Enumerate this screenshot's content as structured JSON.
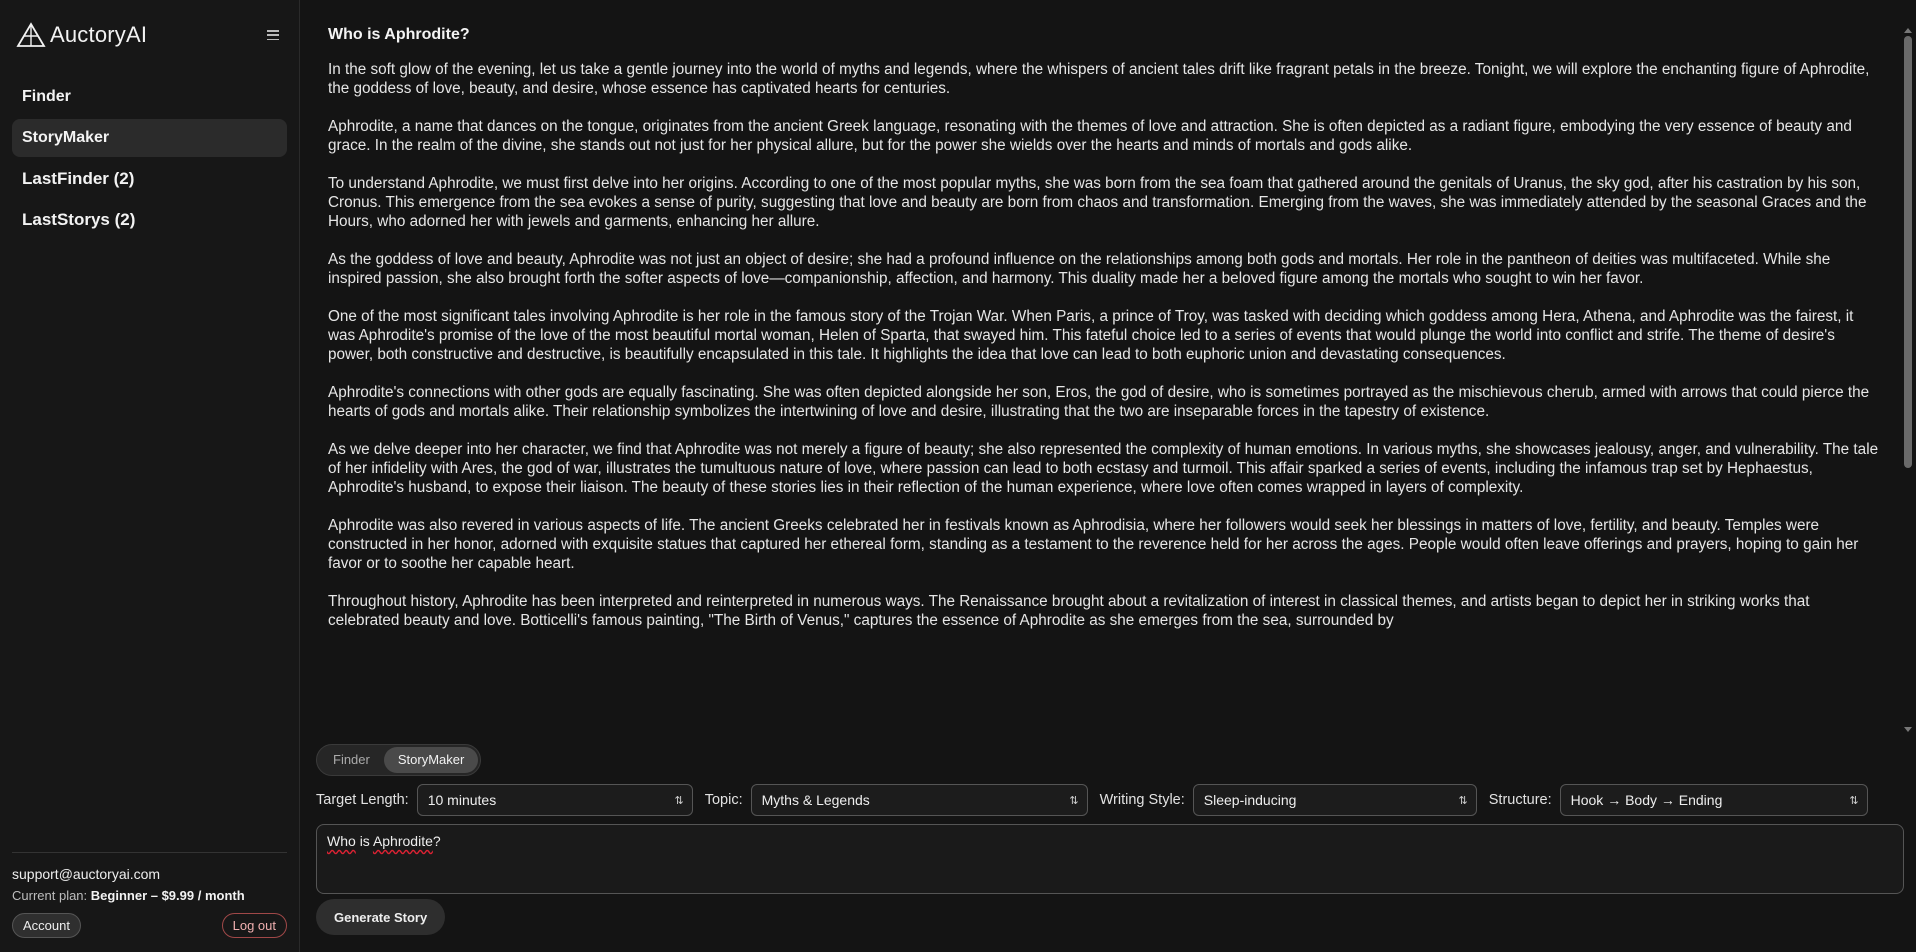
{
  "app": {
    "name": "AuctoryAI"
  },
  "sidebar": {
    "items": [
      {
        "label": "Finder"
      },
      {
        "label": "StoryMaker",
        "active": true
      },
      {
        "label": "LastFinder (2)"
      },
      {
        "label": "LastStorys (2)"
      }
    ],
    "footer": {
      "email": "support@auctoryai.com",
      "plan_label": "Current plan:",
      "plan_value": "Beginner – $9.99 / month",
      "account_label": "Account",
      "logout_label": "Log out"
    }
  },
  "story": {
    "title": "Who is Aphrodite?",
    "paragraphs": [
      "In the soft glow of the evening, let us take a gentle journey into the world of myths and legends, where the whispers of ancient tales drift like fragrant petals in the breeze. Tonight, we will explore the enchanting figure of Aphrodite, the goddess of love, beauty, and desire, whose essence has captivated hearts for centuries.",
      "Aphrodite, a name that dances on the tongue, originates from the ancient Greek language, resonating with the themes of love and attraction. She is often depicted as a radiant figure, embodying the very essence of beauty and grace. In the realm of the divine, she stands out not just for her physical allure, but for the power she wields over the hearts and minds of mortals and gods alike.",
      "To understand Aphrodite, we must first delve into her origins. According to one of the most popular myths, she was born from the sea foam that gathered around the genitals of Uranus, the sky god, after his castration by his son, Cronus. This emergence from the sea evokes a sense of purity, suggesting that love and beauty are born from chaos and transformation. Emerging from the waves, she was immediately attended by the seasonal Graces and the Hours, who adorned her with jewels and garments, enhancing her allure.",
      "As the goddess of love and beauty, Aphrodite was not just an object of desire; she had a profound influence on the relationships among both gods and mortals. Her role in the pantheon of deities was multifaceted. While she inspired passion, she also brought forth the softer aspects of love—companionship, affection, and harmony. This duality made her a beloved figure among the mortals who sought to win her favor.",
      "One of the most significant tales involving Aphrodite is her role in the famous story of the Trojan War. When Paris, a prince of Troy, was tasked with deciding which goddess among Hera, Athena, and Aphrodite was the fairest, it was Aphrodite's promise of the love of the most beautiful mortal woman, Helen of Sparta, that swayed him. This fateful choice led to a series of events that would plunge the world into conflict and strife. The theme of desire's power, both constructive and destructive, is beautifully encapsulated in this tale. It highlights the idea that love can lead to both euphoric union and devastating consequences.",
      "Aphrodite's connections with other gods are equally fascinating. She was often depicted alongside her son, Eros, the god of desire, who is sometimes portrayed as the mischievous cherub, armed with arrows that could pierce the hearts of gods and mortals alike. Their relationship symbolizes the intertwining of love and desire, illustrating that the two are inseparable forces in the tapestry of existence.",
      "As we delve deeper into her character, we find that Aphrodite was not merely a figure of beauty; she also represented the complexity of human emotions. In various myths, she showcases jealousy, anger, and vulnerability. The tale of her infidelity with Ares, the god of war, illustrates the tumultuous nature of love, where passion can lead to both ecstasy and turmoil. This affair sparked a series of events, including the infamous trap set by Hephaestus, Aphrodite's husband, to expose their liaison. The beauty of these stories lies in their reflection of the human experience, where love often comes wrapped in layers of complexity.",
      "Aphrodite was also revered in various aspects of life. The ancient Greeks celebrated her in festivals known as Aphrodisia, where her followers would seek her blessings in matters of love, fertility, and beauty. Temples were constructed in her honor, adorned with exquisite statues that captured her ethereal form, standing as a testament to the reverence held for her across the ages. People would often leave offerings and prayers, hoping to gain her favor or to soothe her capable heart.",
      "Throughout history, Aphrodite has been interpreted and reinterpreted in numerous ways. The Renaissance brought about a revitalization of interest in classical themes, and artists began to depict her in striking works that celebrated beauty and love. Botticelli's famous painting, \"The Birth of Venus,\" captures the essence of Aphrodite as she emerges from the sea, surrounded by"
    ]
  },
  "mode_toggle": {
    "finder_label": "Finder",
    "storymaker_label": "StoryMaker",
    "active": "StoryMaker"
  },
  "controls": {
    "target_length": {
      "label": "Target Length:",
      "value": "10 minutes"
    },
    "topic": {
      "label": "Topic:",
      "value": "Myths & Legends"
    },
    "writing_style": {
      "label": "Writing Style:",
      "value": "Sleep-inducing"
    },
    "structure": {
      "label": "Structure:",
      "value": "Hook → Body → Ending"
    }
  },
  "prompt": {
    "word1": "Who",
    "word2": "is",
    "word3": "Aphrodite",
    "punct": "?"
  },
  "generate_label": "Generate Story"
}
